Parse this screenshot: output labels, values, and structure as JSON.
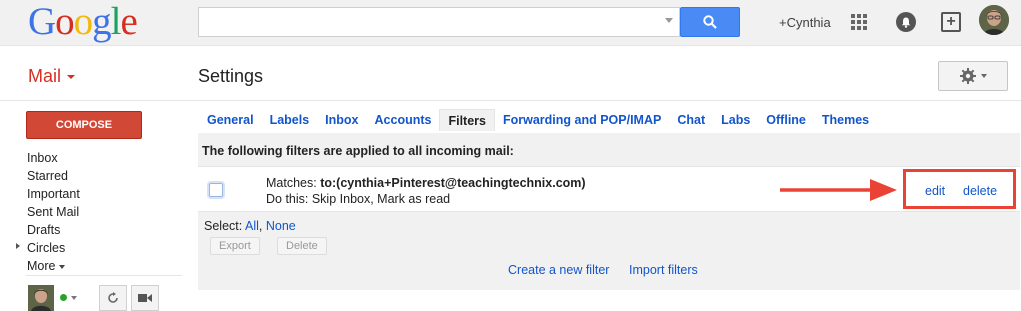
{
  "header": {
    "logo_letters": [
      "G",
      "o",
      "o",
      "g",
      "l",
      "e"
    ],
    "search_value": "",
    "user_name": "+Cynthia"
  },
  "nav": {
    "mail_label": "Mail",
    "compose_label": "COMPOSE",
    "items": [
      "Inbox",
      "Starred",
      "Important",
      "Sent Mail",
      "Drafts",
      "Circles",
      "More"
    ]
  },
  "page": {
    "title": "Settings",
    "tabs": [
      "General",
      "Labels",
      "Inbox",
      "Accounts",
      "Filters",
      "Forwarding and POP/IMAP",
      "Chat",
      "Labs",
      "Offline",
      "Themes"
    ],
    "active_tab": "Filters"
  },
  "filters": {
    "heading": "The following filters are applied to all incoming mail:",
    "matches_prefix": "Matches:",
    "matches_query": "to:(cynthia+Pinterest@teachingtechnix.com)",
    "action_text": "Do this: Skip Inbox, Mark as read",
    "edit_label": "edit",
    "delete_label": "delete",
    "select_prefix": "Select:",
    "select_all": "All",
    "select_none": "None",
    "export_label": "Export",
    "delete_button_label": "Delete",
    "create_label": "Create a new filter",
    "import_label": "Import filters"
  },
  "colors": {
    "accent_blue": "#1155cc",
    "compose_red": "#d14836",
    "annotation_red": "#ea4335"
  },
  "icons": [
    "search-icon",
    "apps-grid-icon",
    "notifications-icon",
    "share-plus-icon",
    "gear-icon",
    "refresh-icon",
    "video-icon",
    "arrow-annotation-icon"
  ]
}
